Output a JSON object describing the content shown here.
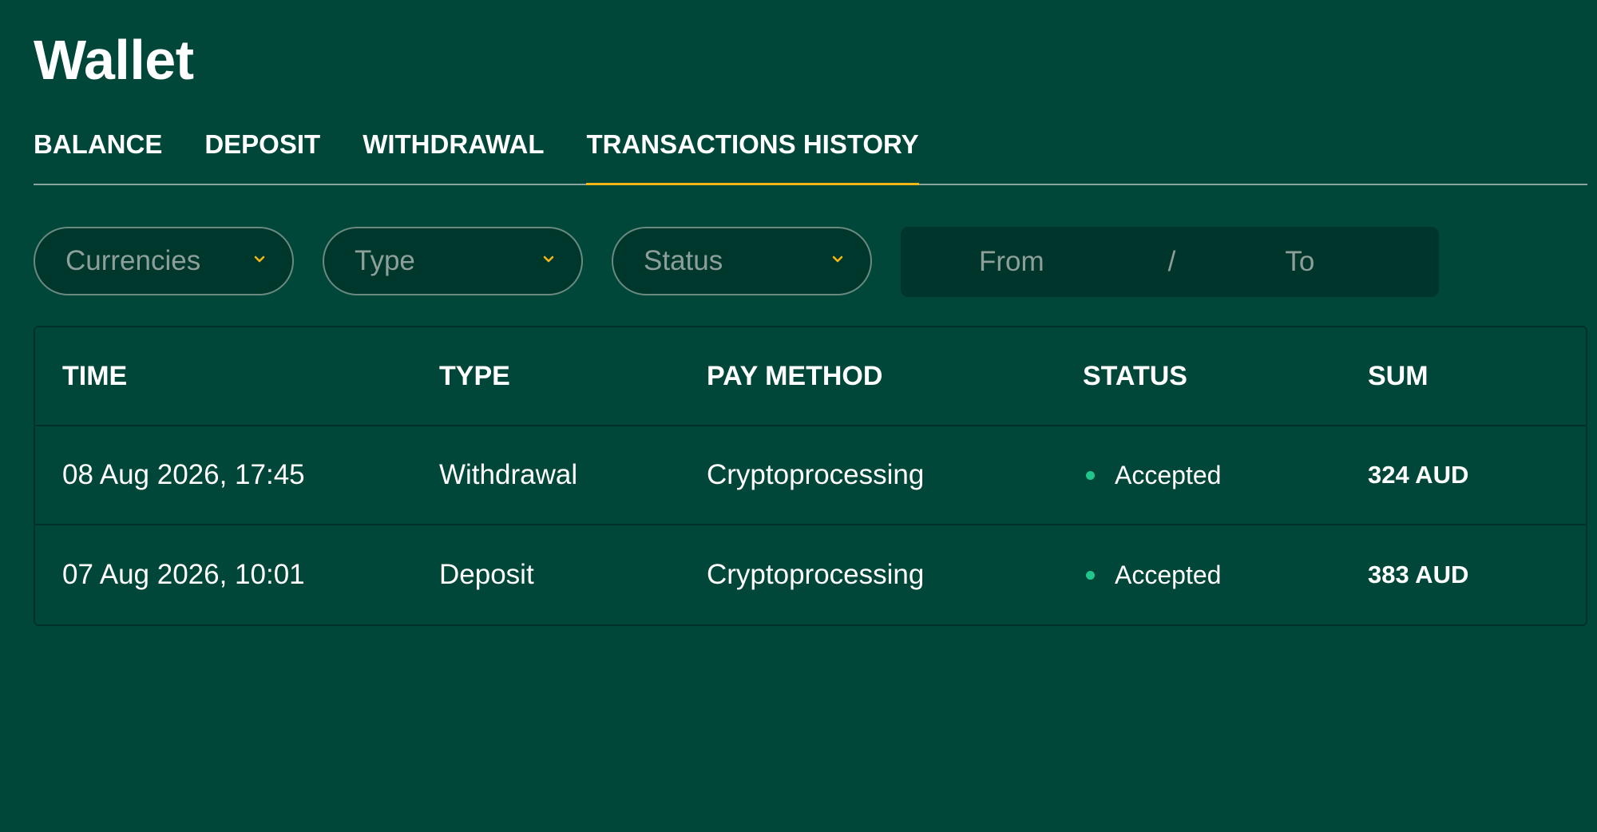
{
  "page": {
    "title": "Wallet"
  },
  "tabs": [
    {
      "label": "BALANCE",
      "active": false
    },
    {
      "label": "DEPOSIT",
      "active": false
    },
    {
      "label": "WITHDRAWAL",
      "active": false
    },
    {
      "label": "TRANSACTIONS HISTORY",
      "active": true
    }
  ],
  "filters": {
    "currencies": {
      "placeholder": "Currencies",
      "icon": "chevron-down-icon"
    },
    "type": {
      "placeholder": "Type",
      "icon": "chevron-down-icon"
    },
    "status": {
      "placeholder": "Status",
      "icon": "chevron-down-icon"
    },
    "date_range": {
      "from": "From",
      "separator": "/",
      "to": "To"
    }
  },
  "table": {
    "columns": [
      "TIME",
      "TYPE",
      "PAY METHOD",
      "STATUS",
      "SUM"
    ],
    "rows": [
      {
        "time": "08 Aug 2026, 17:45",
        "type": "Withdrawal",
        "pay_method": "Cryptoprocessing",
        "status": "Accepted",
        "sum": "324 AUD"
      },
      {
        "time": "07 Aug 2026, 10:01",
        "type": "Deposit",
        "pay_method": "Cryptoprocessing",
        "status": "Accepted",
        "sum": "383 AUD"
      }
    ]
  },
  "colors": {
    "background": "#00473a",
    "accent": "#f2b618",
    "status_accepted": "#22c58b"
  }
}
